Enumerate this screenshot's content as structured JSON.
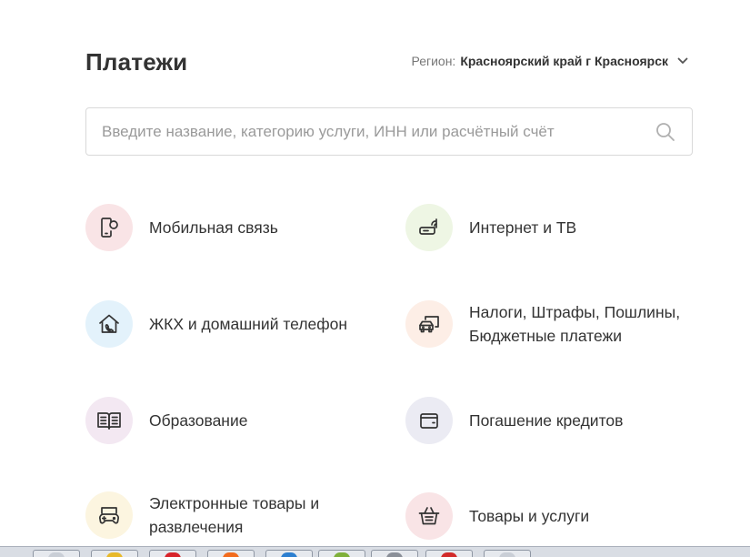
{
  "page": {
    "title": "Платежи",
    "region_label": "Регион:",
    "region_value": "Красноярский край г Красноярск"
  },
  "search": {
    "placeholder": "Введите название, категорию услуги, ИНН или расчётный счёт",
    "value": ""
  },
  "categories": [
    {
      "label": "Мобильная связь",
      "icon": "mobile-phone-icon",
      "bg": "#f9e4e6"
    },
    {
      "label": "Интернет и ТВ",
      "icon": "router-icon",
      "bg": "#eef6e4"
    },
    {
      "label": "ЖКХ и домашний телефон",
      "icon": "house-phone-icon",
      "bg": "#e3f2fb"
    },
    {
      "label": "Налоги, Штрафы, Пошлины,\nБюджетные платежи",
      "icon": "car-document-icon",
      "bg": "#fdeee6"
    },
    {
      "label": "Образование",
      "icon": "book-icon",
      "bg": "#f3e8f2"
    },
    {
      "label": "Погашение кредитов",
      "icon": "wallet-icon",
      "bg": "#ebebf3"
    },
    {
      "label": "Электронные товары и\nразвлечения",
      "icon": "gamepad-icon",
      "bg": "#fcf5e0"
    },
    {
      "label": "Товары и услуги",
      "icon": "basket-icon",
      "bg": "#f9e4e6"
    }
  ],
  "taskbar": {
    "apps": [
      {
        "icon": "window-icon",
        "color": "#c9ced6"
      },
      {
        "icon": "folder-icon",
        "color": "#e8b92a"
      },
      {
        "icon": "opera-icon",
        "color": "#d8232a"
      },
      {
        "icon": "browser-icon",
        "color": "#f26b1d"
      },
      {
        "icon": "edge-icon",
        "color": "#2c7fd0"
      },
      {
        "icon": "spreadsheet-icon",
        "color": "#7fb03a"
      },
      {
        "icon": "tool-icon",
        "color": "#8a8f98"
      },
      {
        "icon": "media-icon",
        "color": "#d22a2a"
      },
      {
        "icon": "window-icon",
        "color": "#c9ced6"
      }
    ]
  }
}
